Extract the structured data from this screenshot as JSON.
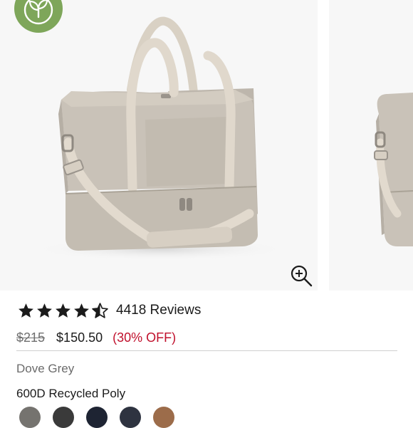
{
  "product": {
    "image_alt": "Dove Grey weekender bag",
    "rating_value": 4.5,
    "rating_max": 5,
    "reviews_text": "4418 Reviews",
    "original_price": "$215",
    "sale_price": "$150.50",
    "discount_text": "(30% OFF)",
    "color_name": "Dove Grey",
    "material": "600D Recycled Poly"
  },
  "icons": {
    "badge": "leaf-sustainability-icon",
    "zoom": "zoom-in-icon",
    "star": "star-icon"
  },
  "colors": {
    "badge_green": "#7ea65a",
    "discount_red": "#c0102c",
    "bag_body": "#c9c2b8",
    "strap": "#ddd5ca"
  },
  "swatches": [
    {
      "color": "#75736f"
    },
    {
      "color": "#3a3a3a"
    },
    {
      "color": "#1e2433"
    },
    {
      "color": "#2e3340"
    },
    {
      "color": "#9c6c4a"
    }
  ]
}
